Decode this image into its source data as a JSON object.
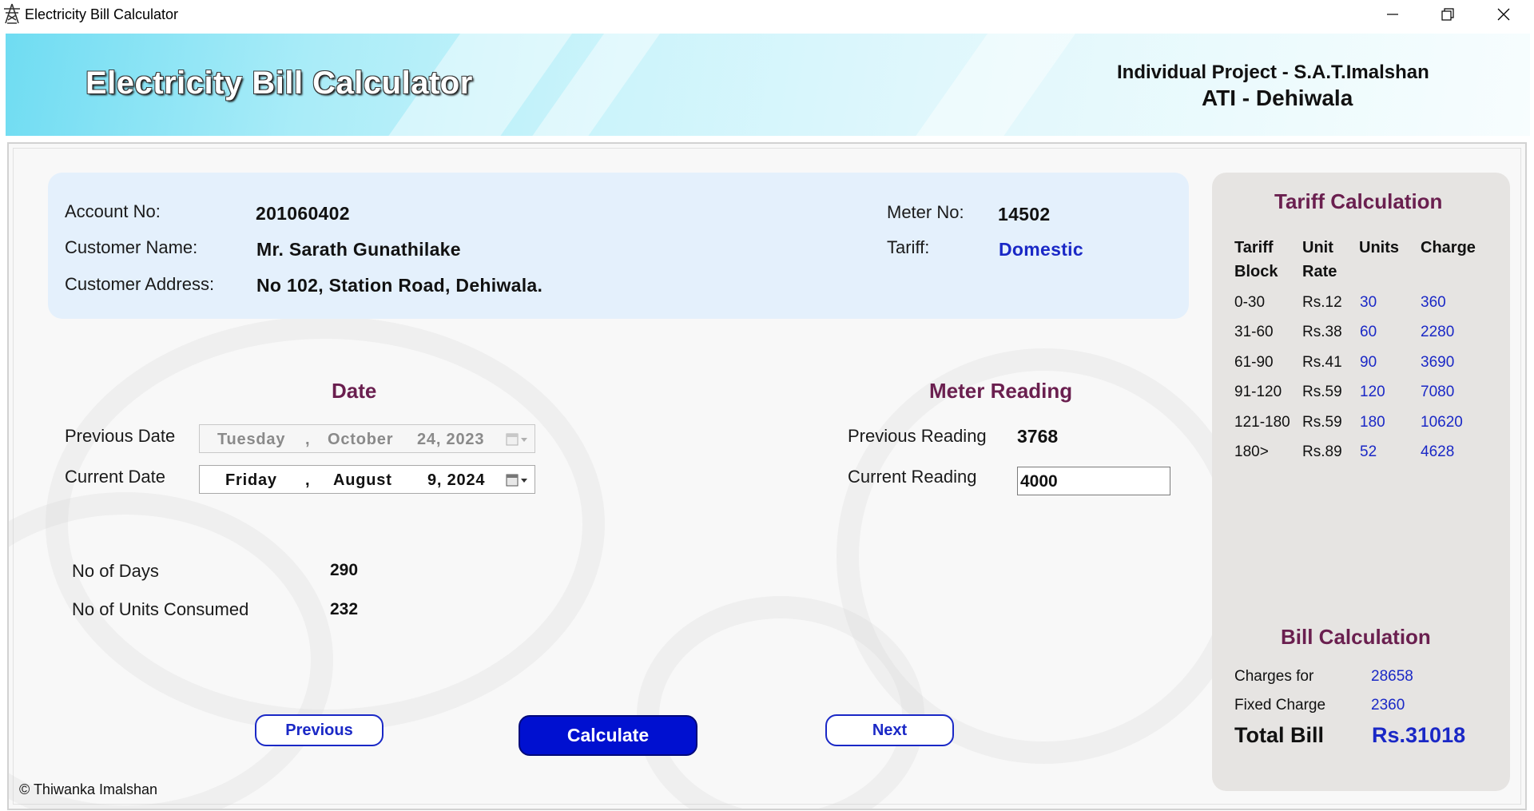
{
  "window": {
    "title": "Electricity Bill Calculator",
    "app_icon": "power-tower-icon"
  },
  "header": {
    "title": "Electricity Bill Calculator",
    "project_line1": "Individual Project - S.A.T.Imalshan",
    "project_line2": "ATI - Dehiwala"
  },
  "customer": {
    "account_label": "Account No:",
    "account_value": "201060402",
    "name_label": "Customer Name:",
    "name_value": "Mr. Sarath Gunathilake",
    "address_label": "Customer Address:",
    "address_value": "No 102, Station Road, Dehiwala.",
    "meter_label": "Meter No:",
    "meter_value": "14502",
    "tariff_label": "Tariff:",
    "tariff_value": "Domestic"
  },
  "date_section": {
    "title": "Date",
    "previous_label": "Previous Date",
    "previous_day": "Tuesday",
    "previous_month": "October",
    "previous_daynum_year": "24, 2023",
    "current_label": "Current Date",
    "current_day": "Friday",
    "current_month": "August",
    "current_daynum_year": "9, 2024",
    "separator": ","
  },
  "meter_section": {
    "title": "Meter Reading",
    "previous_label": "Previous Reading",
    "previous_value": "3768",
    "current_label": "Current Reading",
    "current_value": "4000"
  },
  "summary": {
    "days_label": "No of Days",
    "days_value": "290",
    "units_label": "No of Units Consumed",
    "units_value": "232"
  },
  "buttons": {
    "previous": "Previous",
    "calculate": "Calculate",
    "next": "Next"
  },
  "footer": {
    "copyright": "© Thiwanka Imalshan"
  },
  "tariff": {
    "title": "Tariff Calculation",
    "headers": {
      "block_line1": "Tariff",
      "block_line2": "Block",
      "rate_line1": "Unit",
      "rate_line2": "Rate",
      "units": "Units",
      "charge": "Charge"
    },
    "rows": [
      {
        "block": "0-30",
        "rate": "Rs.12",
        "units": "30",
        "charge": "360"
      },
      {
        "block": "31-60",
        "rate": "Rs.38",
        "units": "60",
        "charge": "2280"
      },
      {
        "block": "61-90",
        "rate": "Rs.41",
        "units": "90",
        "charge": "3690"
      },
      {
        "block": "91-120",
        "rate": "Rs.59",
        "units": "120",
        "charge": "7080"
      },
      {
        "block": "121-180",
        "rate": "Rs.59",
        "units": "180",
        "charge": "10620"
      },
      {
        "block": "180>",
        "rate": "Rs.89",
        "units": "52",
        "charge": "4628"
      }
    ]
  },
  "bill": {
    "title": "Bill Calculation",
    "charges_label": "Charges for",
    "charges_value": "28658",
    "fixed_label": "Fixed Charge",
    "fixed_value": "2360",
    "total_label": "Total Bill",
    "total_value": "Rs.31018"
  },
  "colors": {
    "accent_blue": "#1a28c6",
    "section_title": "#6a1f4f",
    "calculate_button": "#0010d0"
  }
}
